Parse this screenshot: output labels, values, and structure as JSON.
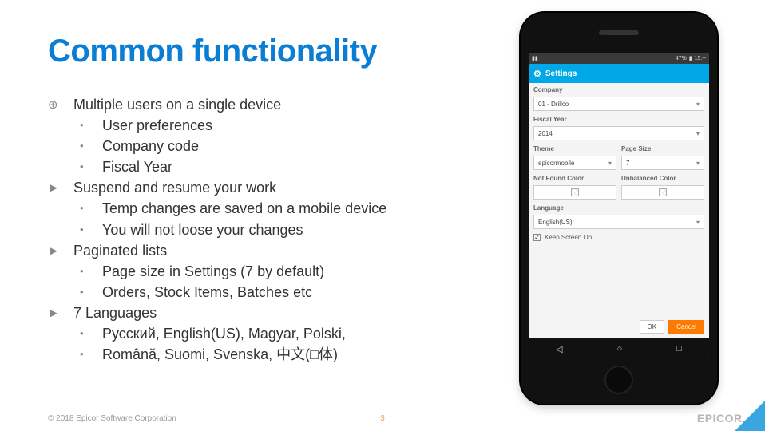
{
  "title": "Common functionality",
  "bullets": {
    "b1": {
      "marker": "⊕",
      "text": "Multiple users on a single device"
    },
    "b1_subs": [
      "User preferences",
      "Company code",
      "Fiscal Year"
    ],
    "b2": {
      "marker": "►",
      "text": "Suspend and resume your work"
    },
    "b2_subs": [
      "Temp changes are saved on a mobile device",
      "You will not loose your changes"
    ],
    "b3": {
      "marker": "►",
      "text": "Paginated lists"
    },
    "b3_subs": [
      "Page size in Settings (7 by default)",
      "Orders, Stock Items, Batches etc"
    ],
    "b4": {
      "marker": "►",
      "text": "7 Languages"
    },
    "b4_subs": [
      "Русский, English(US), Magyar, Polski,",
      "Română, Suomi, Svenska, 中文(□体)"
    ]
  },
  "phone": {
    "statusbar": {
      "carrier": "▮▮",
      "battery": "47%",
      "time": "15:--"
    },
    "header": "Settings",
    "labels": {
      "company": "Company",
      "fiscal_year": "Fiscal Year",
      "theme": "Theme",
      "page_size": "Page Size",
      "not_found_color": "Not Found Color",
      "unbalanced_color": "Unbalanced Color",
      "language": "Language",
      "keep_screen_on": "Keep Screen On"
    },
    "values": {
      "company": "01 - Drillco",
      "fiscal_year": "2014",
      "theme": "epicormobile",
      "page_size": "7",
      "language": "English(US)"
    },
    "buttons": {
      "ok": "OK",
      "cancel": "Cancel"
    },
    "nav": {
      "back": "◁",
      "home": "○",
      "recent": "□"
    }
  },
  "footer": {
    "copyright": "© 2018 Epicor Software Corporation",
    "page_number": "3",
    "logo": "EPICOR"
  }
}
